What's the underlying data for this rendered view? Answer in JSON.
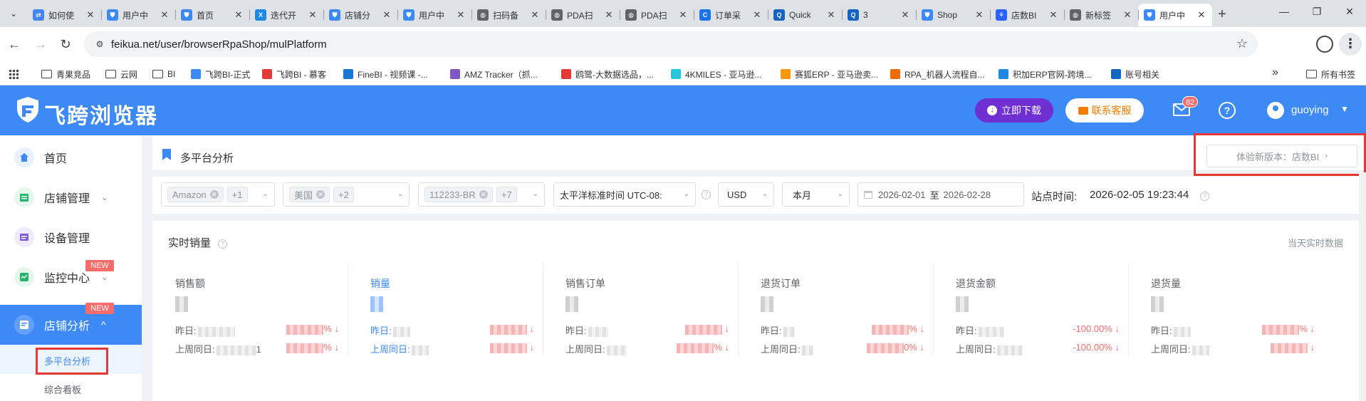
{
  "browser": {
    "tabs": [
      {
        "title": "如何使",
        "color": "#4285f4",
        "glyph": "⇄"
      },
      {
        "title": "用户中",
        "color": "#3d8af7",
        "glyph": "⛊"
      },
      {
        "title": "首页",
        "color": "#3d8af7",
        "glyph": "⛊"
      },
      {
        "title": "迭代开",
        "color": "#1e88e5",
        "glyph": "X"
      },
      {
        "title": "店铺分",
        "color": "#3d8af7",
        "glyph": "⛊"
      },
      {
        "title": "用户中",
        "color": "#3d8af7",
        "glyph": "⛊"
      },
      {
        "title": "扫码备",
        "color": "#5f6368",
        "glyph": "◍"
      },
      {
        "title": "PDA扫",
        "color": "#5f6368",
        "glyph": "◍"
      },
      {
        "title": "PDA扫",
        "color": "#5f6368",
        "glyph": "◍"
      },
      {
        "title": "订单采",
        "color": "#1a73e8",
        "glyph": "C"
      },
      {
        "title": "Quick",
        "color": "#1565c0",
        "glyph": "QBI"
      },
      {
        "title": "3",
        "color": "#1565c0",
        "glyph": "QBI"
      },
      {
        "title": "Shop",
        "color": "#3d8af7",
        "glyph": "⛊"
      },
      {
        "title": "店数BI",
        "color": "#2962ff",
        "glyph": "⚘"
      },
      {
        "title": "新标签",
        "color": "#5f6368",
        "glyph": "◍"
      },
      {
        "title": "用户中",
        "color": "#3d8af7",
        "glyph": "⛊",
        "active": true
      }
    ],
    "url": "feikua.net/user/browserRpaShop/mulPlatform",
    "bookmarks": [
      {
        "label": "青果竞品",
        "type": "folder"
      },
      {
        "label": "云网",
        "type": "folder"
      },
      {
        "label": "BI",
        "type": "folder"
      },
      {
        "label": "飞跨BI-正式",
        "type": "link",
        "color": "#3d8af7"
      },
      {
        "label": "飞跨BI - 慕客",
        "type": "link",
        "color": "#e53935"
      },
      {
        "label": "FineBI - 视频课 -...",
        "type": "link",
        "color": "#1976d2"
      },
      {
        "label": "AMZ Tracker（抓...",
        "type": "link",
        "color": "#7e57c2"
      },
      {
        "label": "鸥鹭-大数据选品，...",
        "type": "link",
        "color": "#e53935"
      },
      {
        "label": "4KMILES - 亚马逊...",
        "type": "link",
        "color": "#26c6da"
      },
      {
        "label": "赛狐ERP - 亚马逊卖...",
        "type": "link",
        "color": "#ff9800"
      },
      {
        "label": "RPA_机器人流程自...",
        "type": "link",
        "color": "#ef6c00"
      },
      {
        "label": "积加ERP官网-跨境...",
        "type": "link",
        "color": "#1e88e5"
      },
      {
        "label": "账号相关",
        "type": "link",
        "color": "#1565c0"
      }
    ],
    "all_bookmarks": "所有书签"
  },
  "header": {
    "brand": "飞跨浏览器",
    "download": "立即下载",
    "service": "联系客服",
    "mail_count": "82",
    "username": "guoying"
  },
  "sidebar": {
    "items": [
      {
        "label": "首页"
      },
      {
        "label": "店铺管理"
      },
      {
        "label": "设备管理"
      },
      {
        "label": "监控中心",
        "badge": "NEW"
      },
      {
        "label": "店铺分析",
        "badge": "NEW"
      }
    ],
    "submenu": [
      {
        "label": "多平台分析"
      },
      {
        "label": "综合看板"
      }
    ]
  },
  "page": {
    "title": "多平台分析",
    "try_new": "体验新版本：店数BI",
    "filters": {
      "platform": {
        "tag": "Amazon",
        "more": "+1"
      },
      "country": {
        "tag": "美国",
        "more": "+2"
      },
      "shop": {
        "tag": "112233-BR",
        "more": "+7"
      },
      "timezone": "太平洋标准时间 UTC-08:",
      "currency": "USD",
      "period": "本月",
      "date_start": "2026-02-01",
      "date_sep": "至",
      "date_end": "2026-02-28"
    },
    "site_time_label": "站点时间:",
    "site_time_value": "2026-02-05 19:23:44"
  },
  "realtime": {
    "title": "实时销量",
    "subtitle": "当天实时数据",
    "metrics": [
      {
        "label": "销售额",
        "yesterday_label": "昨日:",
        "yesterday_suffix": "",
        "yesterday_pct": "%",
        "lastweek_label": "上周同日:",
        "lastweek_suffix": "1",
        "lastweek_pct": "%"
      },
      {
        "label": "销量",
        "yesterday_label": "昨日:",
        "yesterday_suffix": "",
        "yesterday_pct": "",
        "lastweek_label": "上周同日:",
        "lastweek_suffix": "",
        "lastweek_pct": ""
      },
      {
        "label": "销售订单",
        "yesterday_label": "昨日:",
        "yesterday_suffix": "",
        "yesterday_pct": "",
        "lastweek_label": "上周同日:",
        "lastweek_suffix": "",
        "lastweek_pct": "%"
      },
      {
        "label": "退货订单",
        "yesterday_label": "昨日:",
        "yesterday_suffix": "",
        "yesterday_pct": "%",
        "lastweek_label": "上周同日:",
        "lastweek_suffix": "",
        "lastweek_pct": "0%"
      },
      {
        "label": "退货金额",
        "yesterday_label": "昨日:",
        "yesterday_suffix": "",
        "yesterday_pct": "-100.00%",
        "lastweek_label": "上周同日:",
        "lastweek_suffix": "",
        "lastweek_pct": "-100.00%"
      },
      {
        "label": "退货量",
        "yesterday_label": "昨日:",
        "yesterday_suffix": "",
        "yesterday_pct": "%",
        "lastweek_label": "上周同日:",
        "lastweek_suffix": "",
        "lastweek_pct": ""
      }
    ]
  }
}
